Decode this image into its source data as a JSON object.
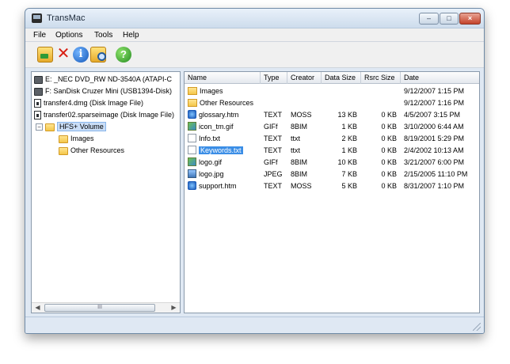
{
  "window": {
    "title": "TransMac",
    "menu": [
      "File",
      "Options",
      "Tools",
      "Help"
    ]
  },
  "toolbar": {
    "icons": [
      "open-icon",
      "delete-icon",
      "info-icon",
      "find-icon",
      "help-icon"
    ],
    "help_glyph": "?"
  },
  "tree": {
    "items": [
      {
        "label": "E: _NEC DVD_RW ND-3540A (ATAPI-C",
        "icon": "drive-icon"
      },
      {
        "label": "F: SanDisk Cruzer Mini (USB1394-Disk)",
        "icon": "drive-icon"
      },
      {
        "label": "transfer4.dmg (Disk Image File)",
        "icon": "disk-image-icon"
      },
      {
        "label": "transfer02.sparseimage (Disk Image File)",
        "icon": "disk-image-icon"
      },
      {
        "label": "HFS+ Volume",
        "icon": "folder-icon",
        "expander": "−"
      },
      {
        "label": "Images",
        "icon": "folder-icon"
      },
      {
        "label": "Other Resources",
        "icon": "folder-icon"
      }
    ],
    "scroll_thumb_text": "III"
  },
  "file_list": {
    "columns": [
      "Name",
      "Type",
      "Creator",
      "Data Size",
      "Rsrc Size",
      "Date"
    ],
    "rows": [
      {
        "name": "Images",
        "type": "",
        "creator": "",
        "data_size": "",
        "rsrc_size": "",
        "date": "9/12/2007 1:15 PM",
        "icon": "folder-icon"
      },
      {
        "name": "Other Resources",
        "type": "",
        "creator": "",
        "data_size": "",
        "rsrc_size": "",
        "date": "9/12/2007 1:16 PM",
        "icon": "folder-icon"
      },
      {
        "name": "glossary.htm",
        "type": "TEXT",
        "creator": "MOSS",
        "data_size": "13 KB",
        "rsrc_size": "0 KB",
        "date": "4/5/2007 3:15 PM",
        "icon": "html-file-icon"
      },
      {
        "name": "icon_tm.gif",
        "type": "GIFf",
        "creator": "8BIM",
        "data_size": "1 KB",
        "rsrc_size": "0 KB",
        "date": "3/10/2000 6:44 AM",
        "icon": "image-file-icon"
      },
      {
        "name": "Info.txt",
        "type": "TEXT",
        "creator": "ttxt",
        "data_size": "2 KB",
        "rsrc_size": "0 KB",
        "date": "8/19/2001 5:29 PM",
        "icon": "text-file-icon"
      },
      {
        "name": "Keywords.txt",
        "type": "TEXT",
        "creator": "ttxt",
        "data_size": "1 KB",
        "rsrc_size": "0 KB",
        "date": "2/4/2002 10:13 AM",
        "icon": "text-file-icon",
        "selected": true
      },
      {
        "name": "logo.gif",
        "type": "GIFf",
        "creator": "8BIM",
        "data_size": "10 KB",
        "rsrc_size": "0 KB",
        "date": "3/21/2007 6:00 PM",
        "icon": "image-file-icon"
      },
      {
        "name": "logo.jpg",
        "type": "JPEG",
        "creator": "8BIM",
        "data_size": "7 KB",
        "rsrc_size": "0 KB",
        "date": "2/15/2005 11:10 PM",
        "icon": "jpeg-file-icon"
      },
      {
        "name": "support.htm",
        "type": "TEXT",
        "creator": "MOSS",
        "data_size": "5 KB",
        "rsrc_size": "0 KB",
        "date": "8/31/2007 1:10 PM",
        "icon": "html-file-icon"
      }
    ]
  }
}
